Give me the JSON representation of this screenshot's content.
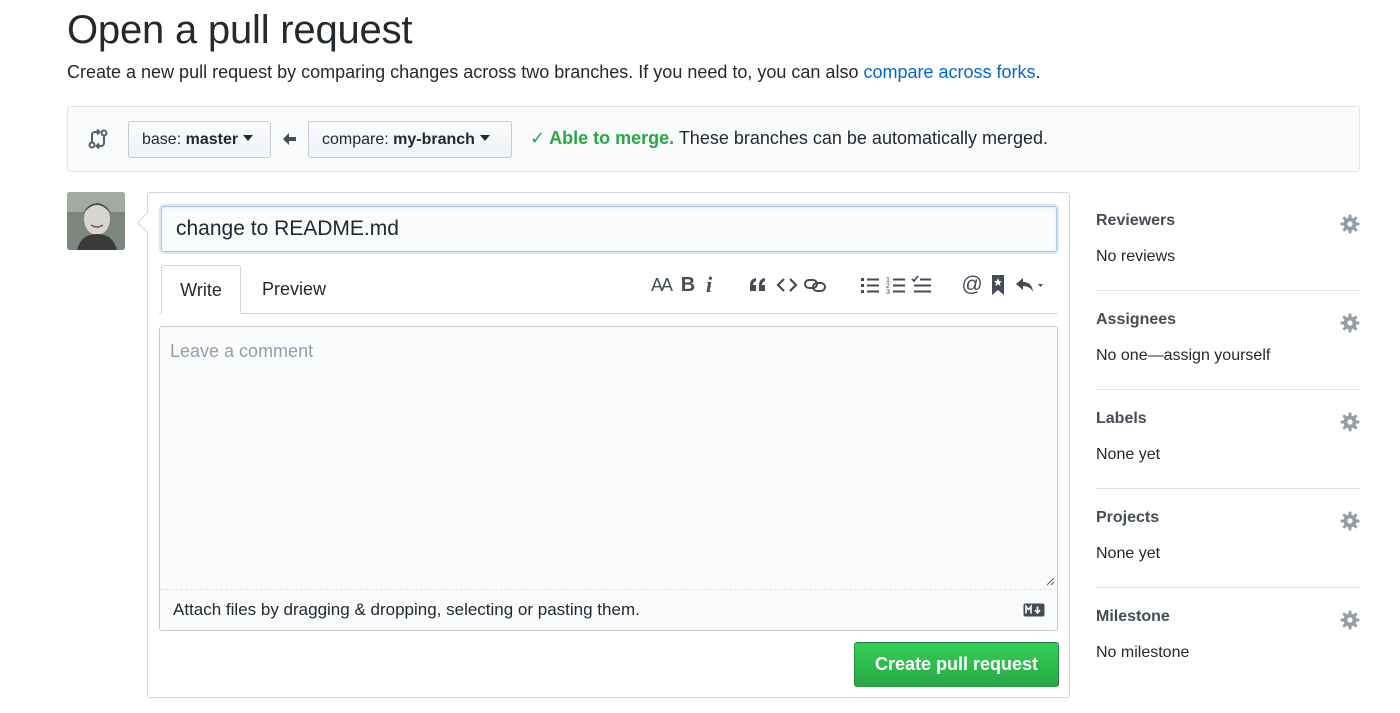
{
  "page": {
    "title": "Open a pull request",
    "subtitle_text": "Create a new pull request by comparing changes across two branches. If you need to, you can also ",
    "subtitle_link": "compare across forks",
    "subtitle_end": "."
  },
  "range": {
    "base_prefix": "base:",
    "base_branch": "master",
    "compare_prefix": "compare:",
    "compare_branch": "my-branch",
    "merge_ok": "Able to merge.",
    "merge_detail": "These branches can be automatically merged."
  },
  "composer": {
    "title_value": "change to README.md",
    "tabs": [
      {
        "label": "Write"
      },
      {
        "label": "Preview"
      }
    ],
    "toolbar": {
      "heading": "AA",
      "bold": "B",
      "italic": "i",
      "at": "@"
    },
    "comment_placeholder": "Leave a comment",
    "attach_text": "Attach files by dragging & dropping, selecting or pasting them.",
    "submit_label": "Create pull request"
  },
  "sidebar": [
    {
      "heading": "Reviewers",
      "value": "No reviews"
    },
    {
      "heading": "Assignees",
      "value": "No one—assign yourself"
    },
    {
      "heading": "Labels",
      "value": "None yet"
    },
    {
      "heading": "Projects",
      "value": "None yet"
    },
    {
      "heading": "Milestone",
      "value": "No milestone"
    }
  ],
  "colors": {
    "link": "#0366d6",
    "success": "#28a745",
    "text": "#24292e",
    "muted": "#959da5"
  },
  "icons": [
    "git-compare-icon",
    "arrow-left-icon",
    "check-icon",
    "gear-icon",
    "markdown-icon"
  ]
}
